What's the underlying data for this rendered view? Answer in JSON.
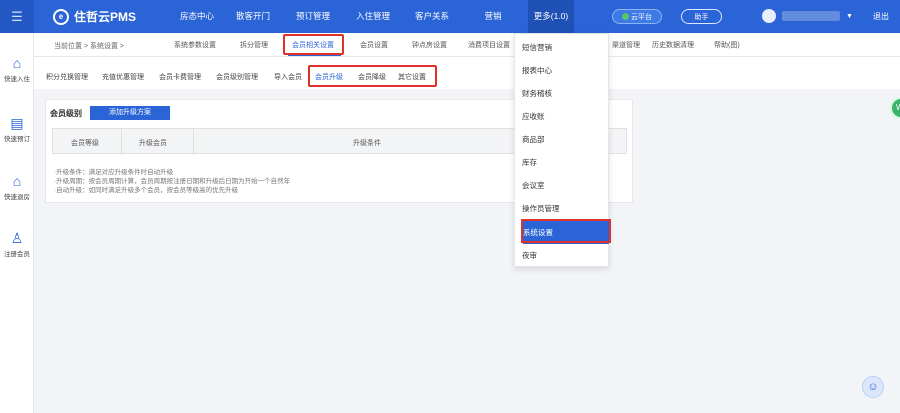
{
  "topbar": {
    "menu_icon": "menu-icon",
    "logo_text": "住哲云PMS",
    "nav": [
      "房态中心",
      "散客开门",
      "预订管理",
      "入住管理",
      "客户关系",
      "营销",
      "更多(1.0)"
    ],
    "cloud_label": "云平台",
    "helper_label": "助手",
    "logout": "退出"
  },
  "sidebar": {
    "items": [
      {
        "icon": "home-icon",
        "label": "快速入住"
      },
      {
        "icon": "document-icon",
        "label": "快速预订"
      },
      {
        "icon": "house-icon",
        "label": "快速退房"
      },
      {
        "icon": "user-add-icon",
        "label": "注册会员"
      }
    ]
  },
  "breadcrumb": {
    "text": "当前位置 > 系统设置 >",
    "tabs": [
      "系统参数设置",
      "拆分管理",
      "会员相关设置",
      "会员设置",
      "钟点房设置",
      "消费项目设置",
      "渠道管理",
      "历史数据清理",
      "帮助(图)"
    ],
    "active_tab": "会员相关设置"
  },
  "subtabs": {
    "items": [
      "积分兑换管理",
      "充值优惠管理",
      "会员卡费管理",
      "会员级别管理",
      "导入会员",
      "会员升级",
      "会员降级",
      "其它设置"
    ],
    "active": "会员升级"
  },
  "panel": {
    "title": "会员级别",
    "add_button": "添加升级方案",
    "columns": [
      "会员等级",
      "升级会员",
      "升级条件"
    ],
    "notes": [
      "·升级条件：满足对应升级条件时自动升级",
      "·升级周期：按会员周期计算，会员周期按注册日期和升级后日期为开始一个自然年",
      "·自动升级：如同时满足升级多个会员，按会员等级高的优先升级"
    ]
  },
  "dropdown": {
    "items": [
      "短信营销",
      "报表中心",
      "财务稽核",
      "应收账",
      "商品部",
      "库存",
      "会议室",
      "操作员管理",
      "系统设置",
      "夜审"
    ],
    "selected": "系统设置"
  },
  "colors": {
    "primary": "#2b64d6",
    "highlight_red": "#e0322b",
    "cloud_green": "#58c46a"
  }
}
